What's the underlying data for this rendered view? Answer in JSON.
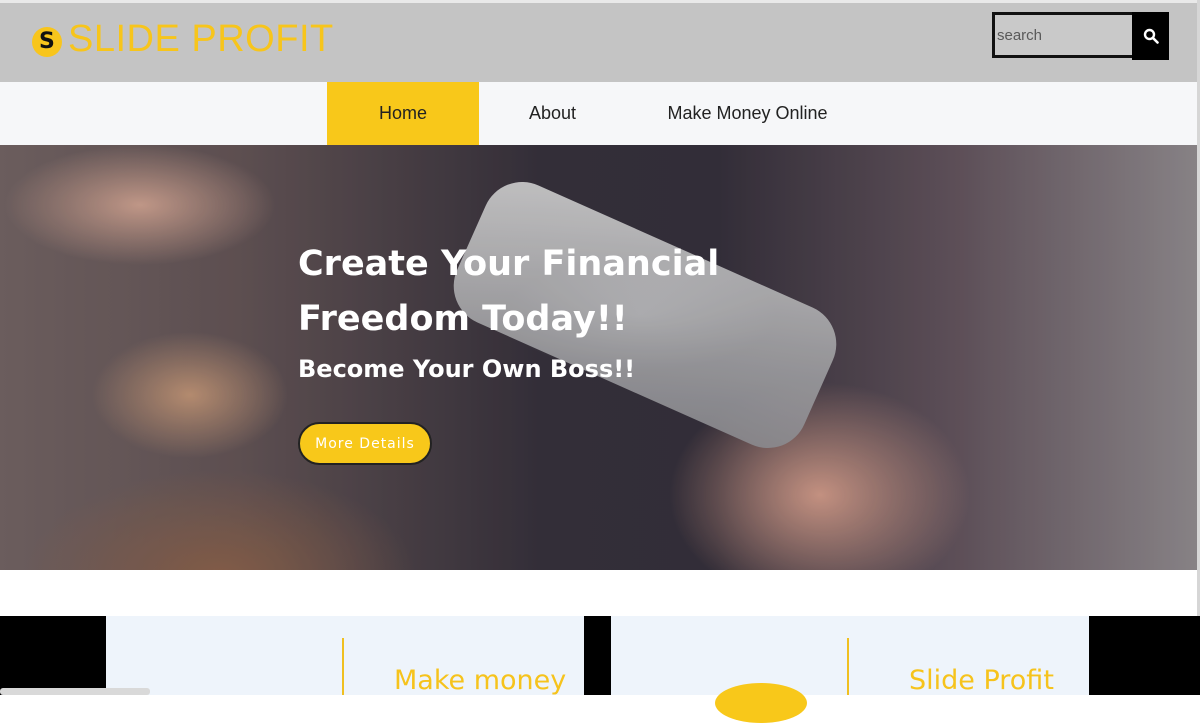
{
  "brand": {
    "name": "SLIDE PROFIT",
    "coin_letter": "S",
    "color": "#f7c51b"
  },
  "search": {
    "placeholder": "search",
    "button_icon": "search-icon"
  },
  "nav": {
    "items": [
      {
        "label": "Home",
        "active": true
      },
      {
        "label": "About",
        "active": false
      },
      {
        "label": "Make Money Online",
        "active": false
      }
    ],
    "active_color": "#f8c81a"
  },
  "hero": {
    "title": "Create Your Financial Freedom Today!!",
    "subtitle": "Become Your Own Boss!!",
    "button_label": "More Details"
  },
  "cards": [
    {
      "title": "Make money"
    },
    {
      "title": "Slide Profit"
    }
  ]
}
